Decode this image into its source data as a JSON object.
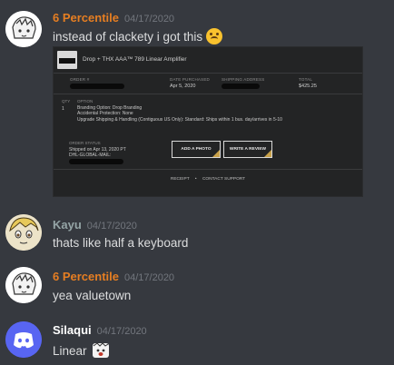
{
  "colors": {
    "background": "#36393f",
    "username_orange": "#e67e22",
    "username_teal": "#95a5a6",
    "username_white": "#ffffff",
    "timestamp": "#72767d",
    "text": "#dcddde"
  },
  "messages": [
    {
      "username": "6 Percentile",
      "timestamp": "04/17/2020",
      "text": "instead of clackety i got this",
      "emoji": "upside-down-face-emoji",
      "avatar": "anime-girl-avatar"
    },
    {
      "username": "Kayu",
      "timestamp": "04/17/2020",
      "text": "thats like half a keyboard",
      "avatar": "anime-face-avatar"
    },
    {
      "username": "6 Percentile",
      "timestamp": "04/17/2020",
      "text": "yea valuetown",
      "avatar": "anime-girl-avatar"
    },
    {
      "username": "Silaqui",
      "timestamp": "04/17/2020",
      "text": "Linear",
      "emoji": "custom-face-emoji",
      "avatar": "discord-logo-avatar"
    }
  ],
  "order": {
    "product_title": "Drop + THX AAA™ 789 Linear Amplifier",
    "labels": {
      "order_num": "ORDER #",
      "date": "DATE PURCHASED",
      "shipping": "SHIPPING ADDRESS",
      "total": "TOTAL",
      "qty": "QTY",
      "option": "OPTION",
      "status": "ORDER STATUS"
    },
    "date_value": "Apr 5, 2020",
    "total_value": "$425.25",
    "qty_value": "1",
    "options": [
      "Branding Option: Drop Branding",
      "Accidental Protection: None",
      "Upgrade Shipping & Handling (Contiguous US Only): Standard: Ships within 1 bus. day/arrives in 5-10"
    ],
    "status_lines": [
      "Shipped on Apr 13, 2020 PT",
      "DHL-GLOBAL-MAIL:"
    ],
    "buttons": {
      "add_photo": "ADD A PHOTO",
      "write_review": "WRITE A REVIEW"
    },
    "footer": {
      "receipt": "RECEIPT",
      "sep": "•",
      "contact": "CONTACT SUPPORT"
    }
  }
}
